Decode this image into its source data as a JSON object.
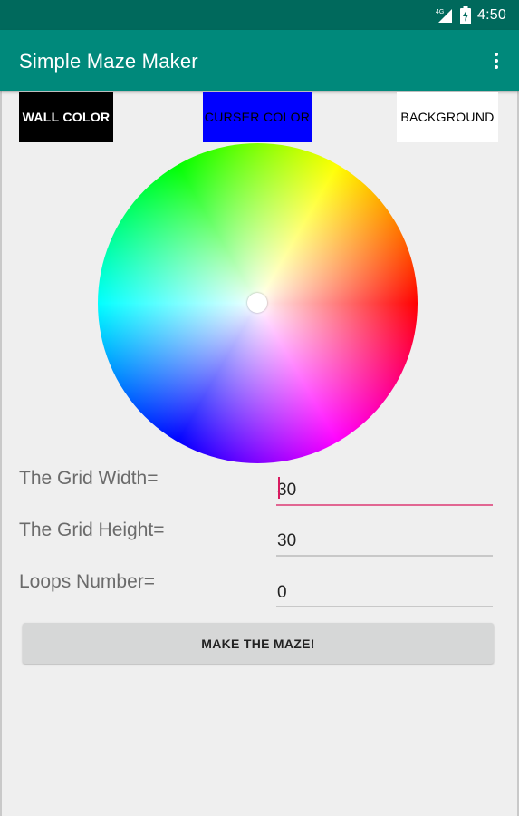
{
  "status_bar": {
    "network_label": "4G",
    "time": "4:50"
  },
  "app_bar": {
    "title": "Simple Maze Maker",
    "overflow_icon": "more-vert-icon"
  },
  "color_buttons": {
    "wall": {
      "label": "WALL COLOR",
      "color": "#000000"
    },
    "curser": {
      "label": "CURSER COLOR",
      "color": "#0000ff"
    },
    "background": {
      "label": "BACKGROUND",
      "color": "#ffffff"
    }
  },
  "form": {
    "grid_width": {
      "label": "The Grid Width=",
      "value": "30"
    },
    "grid_height": {
      "label": "The Grid Height=",
      "value": "30"
    },
    "loops": {
      "label": "Loops Number=",
      "value": "0"
    }
  },
  "make_button": {
    "label": "MAKE THE MAZE!"
  },
  "colors": {
    "status_bar": "#00695c",
    "app_bar": "#00897b",
    "accent": "#d81b60",
    "button_bg": "#d6d7d7",
    "screen_bg": "#efefef"
  }
}
